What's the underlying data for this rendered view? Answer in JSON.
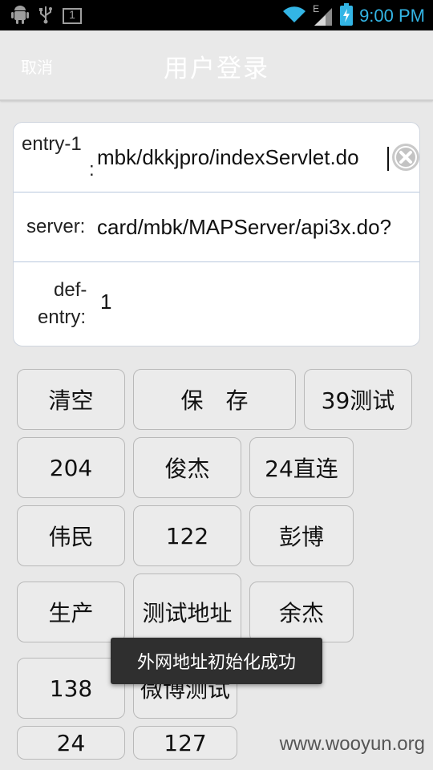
{
  "status_bar": {
    "time": "9:00 PM",
    "network_letter": "E",
    "icons": [
      "android-icon",
      "usb-icon",
      "notification-1-icon",
      "wifi-icon",
      "signal-icon",
      "battery-charging-icon"
    ],
    "notification_number": "1",
    "time_color": "#33b5e5"
  },
  "header": {
    "cancel_label": "取消",
    "title": "用户登录"
  },
  "form": {
    "entry1": {
      "label_line1": "entry-1",
      "label_line2": ":",
      "value": "mbk/dkkjpro/indexServlet.do"
    },
    "server": {
      "label": "server:",
      "value": "card/mbk/MAPServer/api3x.do?"
    },
    "def_entry": {
      "label_line1": "def-",
      "label_line2": "entry:",
      "value": "1"
    }
  },
  "buttons": {
    "clear": "清空",
    "save": "保　存",
    "test39": "39测试",
    "b204": "204",
    "junjie": "俊杰",
    "direct24": "24直连",
    "weimin": "伟民",
    "b122": "122",
    "pengbo": "彭博",
    "production": "生产",
    "test_address": "测试地址",
    "yujie": "余杰",
    "b138": "138",
    "weibo_test": "微博测试",
    "b24": "24",
    "b127": "127"
  },
  "toast": "外网地址初始化成功",
  "watermark": "www.wooyun.org"
}
